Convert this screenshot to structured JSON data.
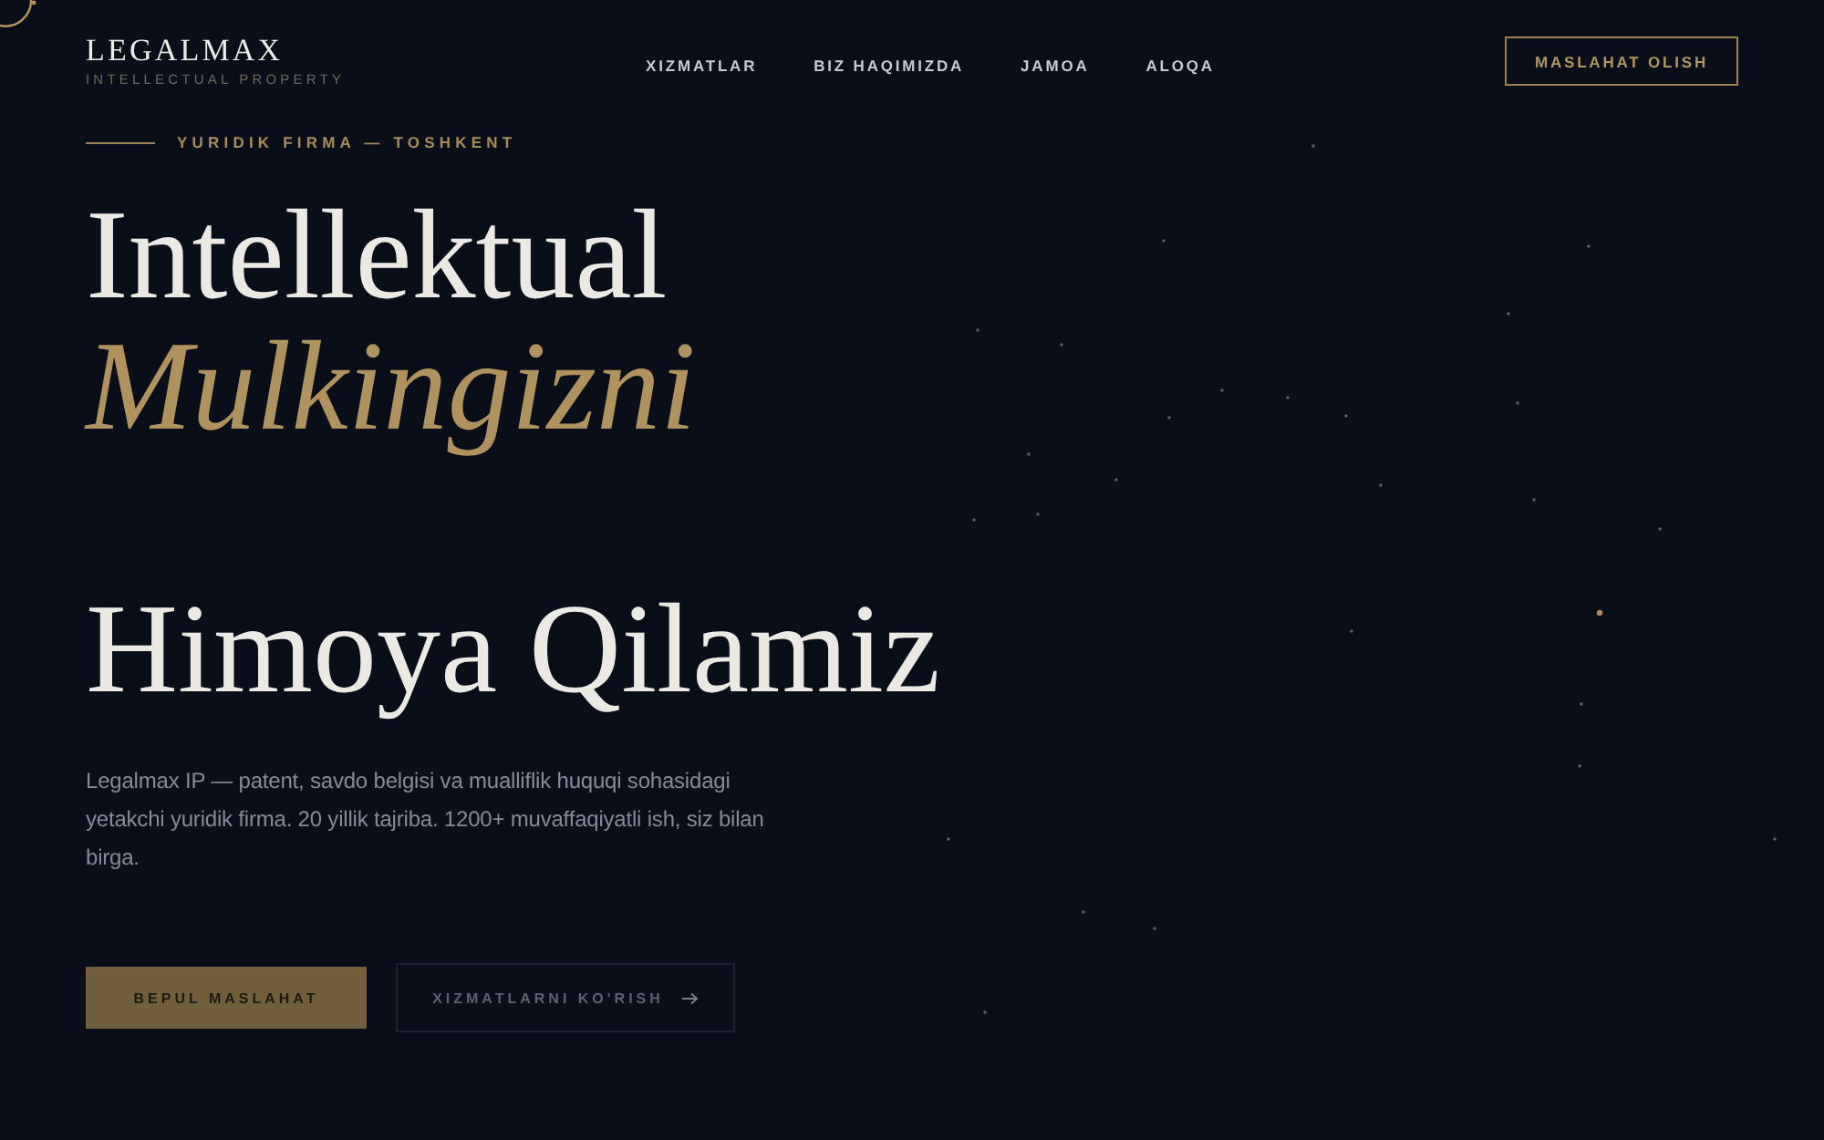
{
  "logo": {
    "name": "LEGALMAX",
    "tagline": "INTELLECTUAL PROPERTY"
  },
  "nav": {
    "links": [
      "XIZMATLAR",
      "BIZ HAQIMIZDA",
      "JAMOA",
      "ALOQA"
    ],
    "cta": "MASLAHAT OLISH"
  },
  "hero": {
    "eyebrow": "YURIDIK FIRMA — TOSHKENT",
    "headline": [
      {
        "text": "Intellektual",
        "kind": "plain"
      },
      {
        "text": "Mulkingizni",
        "kind": "accent"
      },
      {
        "text": "Himoya Qilamiz",
        "kind": "plain"
      }
    ],
    "description": "Legalmax IP — patent, savdo belgisi va mualliflik huquqi sohasidagi yetakchi yuridik firma. 20 yillik tajriba. 1200+ muvaffaqiyatli ish, siz bilan birga.",
    "buttons": [
      {
        "label": "BEPUL MASLAHAT",
        "kind": "primary"
      },
      {
        "label": "XIZMATLARNI KO'RISH",
        "kind": "secondary"
      }
    ]
  }
}
